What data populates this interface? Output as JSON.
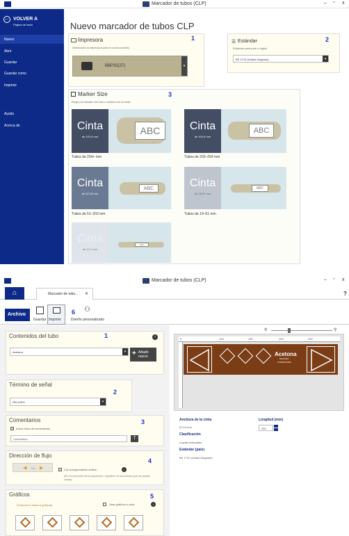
{
  "window": {
    "title": "Marcador de tubos (CLP)",
    "min": "–",
    "max": "▫",
    "close": "x"
  },
  "sidebar": {
    "back_title": "VOLVER A",
    "back_sub": "Página de inicio",
    "items": [
      "Nuevo",
      "Abrir",
      "Guardar",
      "Guardar como",
      "Imprimir",
      "Ayuda",
      "Acerca de"
    ]
  },
  "new_page": {
    "title": "Nuevo marcador de tubos CLP",
    "printer_label": "Impresora",
    "printer_hint": "Seleccione la impresora para el nuevo archivo.",
    "printer_value": "BBP35(37)",
    "standard_label": "Estándar",
    "standard_hint": "Estándar para país o región",
    "standard_value": "BS 1710 (United Kingdom)",
    "marker_size_label": "Marker Size",
    "marker_size_hint": "Elegir por tamaño de tubo o anchura de la cinta.",
    "badges": [
      "1",
      "2",
      "3"
    ],
    "sizes": [
      {
        "word": "Cinta",
        "width": "de 101,6 mm",
        "tube_label": "ABC",
        "caption": "Tubos de 254+ mm"
      },
      {
        "word": "Cinta",
        "width": "de 101,6 mm",
        "tube_label": "ABC",
        "caption": "Tubos de 203–254 mm"
      },
      {
        "word": "Cinta",
        "width": "de 57,15 mm",
        "tube_label": "ABC",
        "caption": "Tubos de 51–203 mm"
      },
      {
        "word": "Cinta",
        "width": "de 28,57 mm",
        "tube_label": "ABC",
        "caption": "Tubos de 19–51 mm"
      },
      {
        "word": "Cinta",
        "width": "de 12,7 mm",
        "tube_label": "ABC",
        "caption": ""
      }
    ]
  },
  "editor": {
    "tab_label": "Marcador de tubo...",
    "tab_close": "✕",
    "help": "?",
    "ribbon_archivo": "Archivo",
    "ribbon_buttons": [
      "Guardar",
      "Imprimir",
      "Diseño personalizado"
    ],
    "badge6": "6",
    "contents_title": "Contenidos del tubo",
    "contents_value": "Acetona",
    "add_button": "Añadir nuevo",
    "signal_title": "Término de señal",
    "signal_value": "PELIGRO",
    "comments_title": "Comentarios",
    "comments_checkbox": "Incluir línea de comentarios",
    "comments_value": "Comentario",
    "comments_t": "T",
    "flow_title": "Dirección de flujo",
    "flow_abc": "ABC",
    "flow_cutout": "Cut out pipemarker outline",
    "flow_note": "(En el momento de la impresión, requiere un suministro que se pueda cortar)",
    "graphics_title": "Gráficos",
    "graphics_hint": "[Seleccione hasta 6 gráficos]",
    "graphics_color": "Usar gráficos a color",
    "badges": [
      "1",
      "2",
      "3",
      "4",
      "5"
    ],
    "preview_text": "Acetona",
    "preview_sub": "PELIGRO",
    "preview_sub2": "COMENTARIO",
    "ruler_ticks": [
      "5",
      "100",
      "150",
      "200",
      "250"
    ],
    "info": {
      "width_label": "Anchura de la cinta",
      "width_value": "57,15 mm",
      "class_label": "Clasificación",
      "class_value": "Líquido inflamable",
      "std_label": "Estándar (país)",
      "std_value": "BS 1710 (United Kingdom)",
      "length_label": "Longitud (mm)",
      "length_value": "250"
    }
  }
}
